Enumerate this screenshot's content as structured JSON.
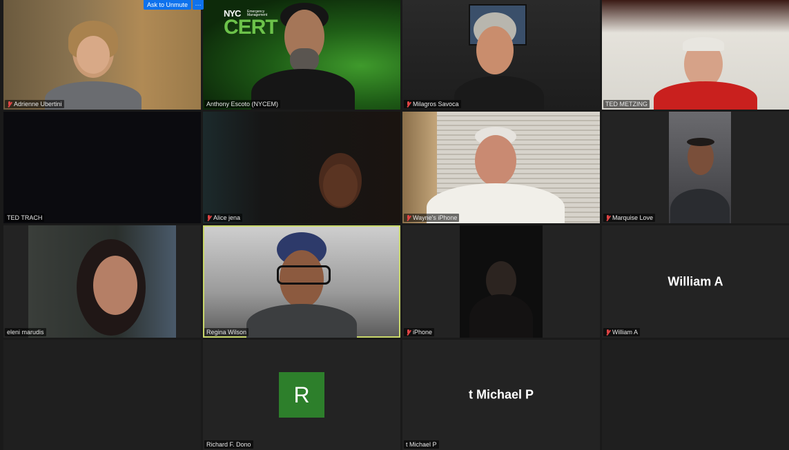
{
  "controls": {
    "ask_to_unmute": "Ask to Unmute",
    "more": "···"
  },
  "logo": {
    "nyc": "NYC",
    "sub": "Emergency Management",
    "cert": "CERT"
  },
  "participants": [
    {
      "name": "Adrienne Ubertini",
      "muted": true
    },
    {
      "name": "Anthony Escoto (NYCEM)",
      "muted": false
    },
    {
      "name": "Milagros Savoca",
      "muted": true
    },
    {
      "name": "TED METZING",
      "muted": false
    },
    {
      "name": "TED TRACH",
      "muted": false
    },
    {
      "name": "Alice jena",
      "muted": true
    },
    {
      "name": "Wayne's iPhone",
      "muted": true
    },
    {
      "name": "Marquise Love",
      "muted": true
    },
    {
      "name": "eleni marudis",
      "muted": false
    },
    {
      "name": "Regina Wilson",
      "muted": false,
      "active_speaker": true
    },
    {
      "name": "iPhone",
      "muted": true
    },
    {
      "name": "William A",
      "muted": true,
      "video_off_label": "William A"
    },
    {
      "name": "Richard F. Dono",
      "muted": false,
      "avatar_letter": "R"
    },
    {
      "name": "t Michael P",
      "muted": false,
      "video_off_label": "t Michael P"
    }
  ],
  "colors": {
    "accent_blue": "#0e72ed",
    "avatar_green": "#2d7f2b",
    "active_border": "#c9d86a",
    "muted_red": "#e04444"
  }
}
